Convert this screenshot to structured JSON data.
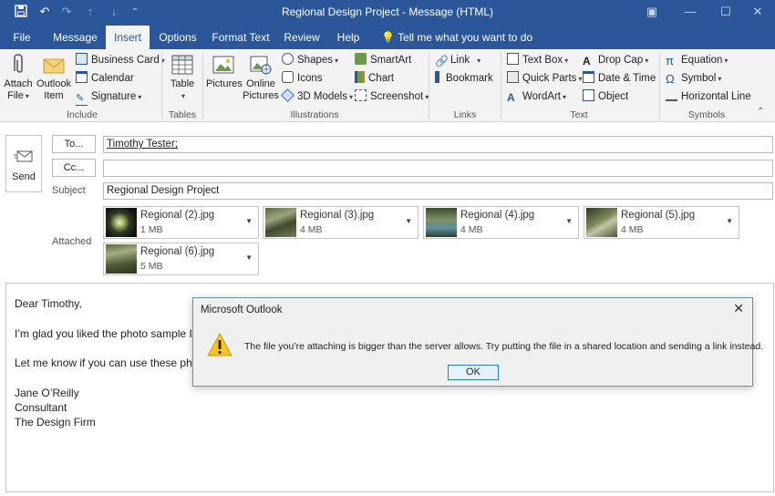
{
  "window": {
    "title": "Regional Design Project  -  Message (HTML)",
    "quick_access": {
      "save_icon": "save-icon",
      "undo_icon": "undo-icon",
      "redo_icon": "redo-icon",
      "up_icon": "arrow-up-icon",
      "down_icon": "arrow-down-icon",
      "customize_icon": "customize-icon"
    },
    "controls": {
      "restore": "▣",
      "minimize": "—",
      "maximize": "☐",
      "close": "✕"
    }
  },
  "tabs": [
    "File",
    "Message",
    "Insert",
    "Options",
    "Format Text",
    "Review",
    "Help"
  ],
  "active_tab": "Insert",
  "tell_me": "Tell me what you want to do",
  "ribbon": {
    "include": {
      "label": "Include",
      "attach_file": [
        "Attach",
        "File"
      ],
      "outlook_item": [
        "Outlook",
        "Item"
      ],
      "business_card": "Business Card",
      "calendar": "Calendar",
      "signature": "Signature"
    },
    "tables": {
      "label": "Tables",
      "table": "Table"
    },
    "illustrations": {
      "label": "Illustrations",
      "pictures": "Pictures",
      "online_pictures": [
        "Online",
        "Pictures"
      ],
      "shapes": "Shapes",
      "icons": "Icons",
      "models_3d": "3D Models",
      "smartart": "SmartArt",
      "chart": "Chart",
      "screenshot": "Screenshot"
    },
    "links": {
      "label": "Links",
      "link": "Link",
      "bookmark": "Bookmark"
    },
    "text": {
      "label": "Text",
      "text_box": "Text Box",
      "quick_parts": "Quick Parts",
      "wordart": "WordArt",
      "drop_cap": "Drop Cap",
      "date_time": "Date & Time",
      "object": "Object"
    },
    "symbols": {
      "label": "Symbols",
      "equation": "Equation",
      "symbol": "Symbol",
      "horizontal_line": "Horizontal Line"
    }
  },
  "compose": {
    "send_label": "Send",
    "to_button": "To...",
    "cc_button": "Cc...",
    "to_value": "Timothy Tester;",
    "cc_value": "",
    "subject_label": "Subject",
    "subject_value": "Regional Design Project",
    "attached_label": "Attached",
    "attachments": [
      {
        "name": "Regional (2).jpg",
        "size": "1 MB"
      },
      {
        "name": "Regional (3).jpg",
        "size": "4 MB"
      },
      {
        "name": "Regional (4).jpg",
        "size": "4 MB"
      },
      {
        "name": "Regional (5).jpg",
        "size": "4 MB"
      },
      {
        "name": "Regional (6).jpg",
        "size": "5 MB"
      }
    ]
  },
  "body_lines": [
    "Dear Timothy,",
    "I’m glad you liked the photo sample I s",
    "Let me know if you can use these phot",
    "Jane O’Reilly",
    "Consultant",
    "The Design Firm"
  ],
  "dialog": {
    "title": "Microsoft Outlook",
    "message": "The file you’re attaching is bigger than the server allows. Try putting the file in a shared location and sending a link instead.",
    "ok_label": "OK",
    "icon": "warning-icon"
  },
  "colors": {
    "title_bar": "#2b579a",
    "ribbon_bg": "#f3f3f3",
    "accent": "#2b579a",
    "warning": "#f7c51e"
  }
}
